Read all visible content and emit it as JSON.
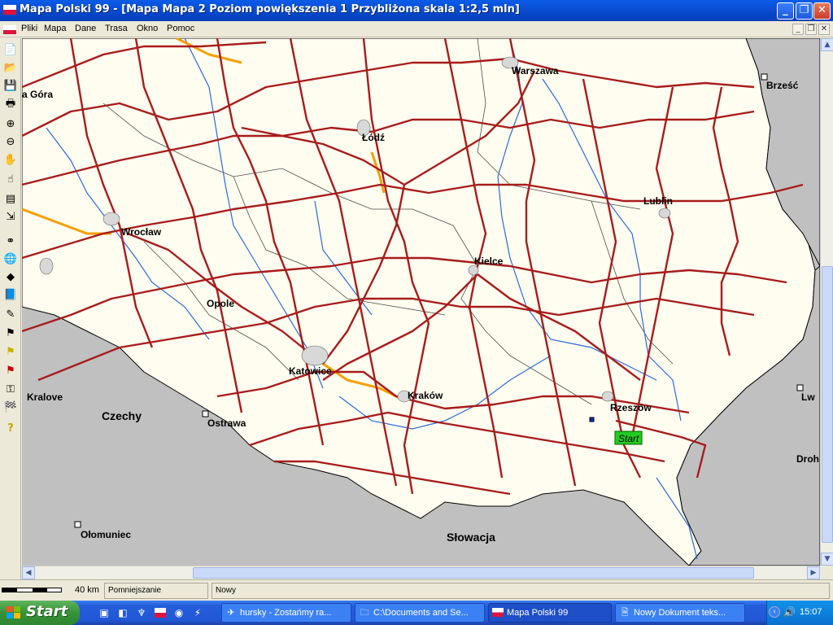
{
  "window": {
    "title": "Mapa Polski 99 - [Mapa Mapa 2 Poziom powiększenia 1 Przybliżona skala 1:2,5 mln]",
    "flag_colors": [
      "#ffffff",
      "#dc143c"
    ]
  },
  "menu": {
    "items": [
      "Pliki",
      "Mapa",
      "Dane",
      "Trasa",
      "Okno",
      "Pomoc"
    ]
  },
  "toolbar": {
    "tools": [
      "new-icon",
      "open-icon",
      "save-icon",
      "print-icon",
      "zoom-in-icon",
      "zoom-out-icon",
      "hand-icon",
      "pointer-icon",
      "info-icon",
      "route-icon",
      "binoculars-icon",
      "globe-icon",
      "eraser-icon",
      "book-icon",
      "pencil-icon",
      "green-flag-icon",
      "yellow-flag-icon",
      "red-flag-icon",
      "key-icon",
      "checkered-flag-icon",
      "help-icon"
    ]
  },
  "map": {
    "colors": {
      "land_poland": "#fffdf0",
      "land_other": "#c0c0c0",
      "road": "#b22222",
      "highway": "#f5a000",
      "river": "#2b6cd6",
      "border": "#000000"
    },
    "cities": [
      "Warszawa",
      "Brześć",
      "Łódź",
      "Lublin",
      "Wrocław",
      "Kielce",
      "Opole",
      "Katowice",
      "Kraków",
      "Rzeszów",
      "Ostrawa",
      "Ołomuniec",
      "Kralove",
      "Czechy",
      "Słowacja",
      "a Góra",
      "Lw",
      "Droh"
    ],
    "start_marker": "Start"
  },
  "status": {
    "scale_label": "40 km",
    "zoom_label": "Pomniejszanie",
    "doc_label": "Nowy"
  },
  "taskbar": {
    "start_label": "Start",
    "tasks": [
      "hursky - Zostańmy ra...",
      "C:\\Documents and Se...",
      "Mapa Polski 99",
      "Nowy Dokument teks..."
    ],
    "clock": "15:07"
  }
}
